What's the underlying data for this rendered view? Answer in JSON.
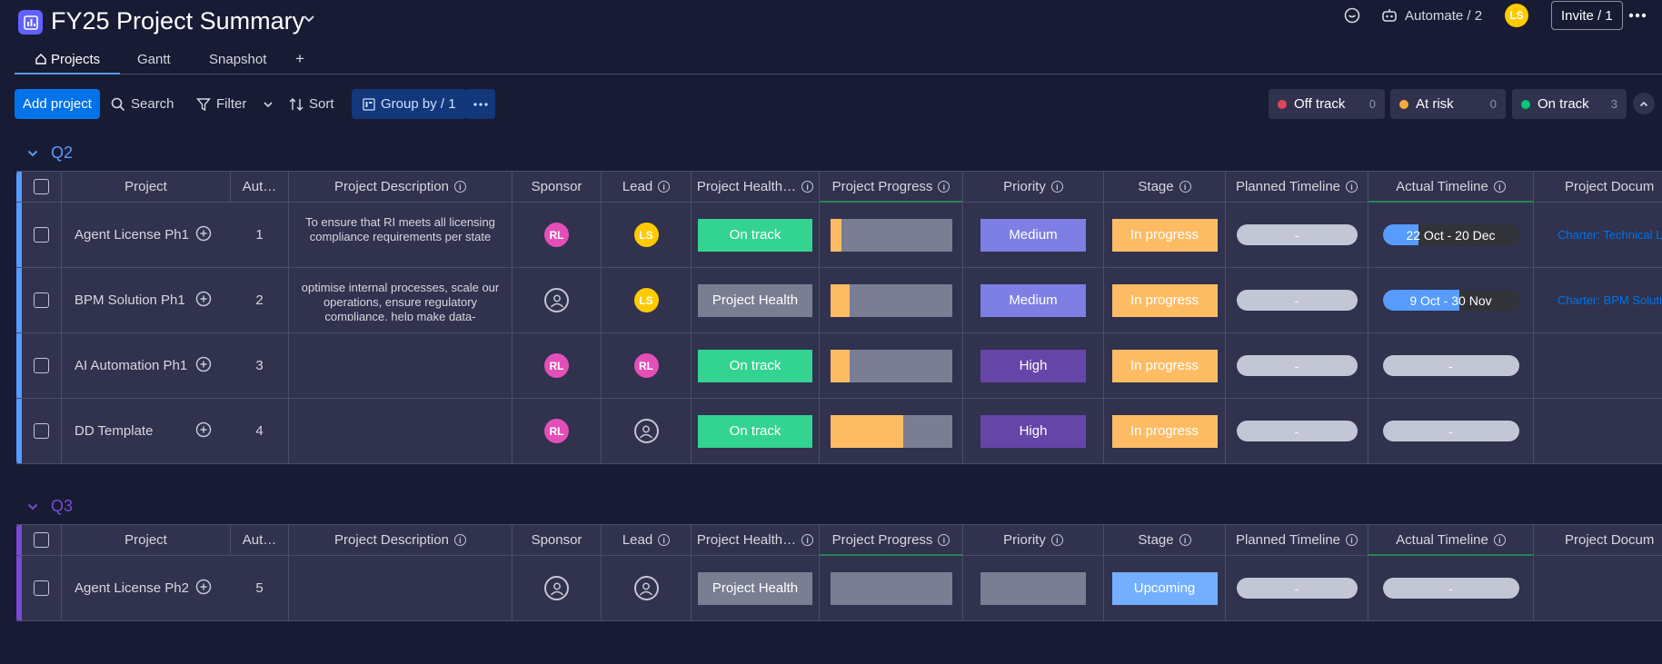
{
  "header": {
    "title": "FY25 Project Summary",
    "automate_label": "Automate / 2",
    "user_initials": "LS",
    "invite_label": "Invite / 1"
  },
  "tabs": [
    {
      "label": "Projects"
    },
    {
      "label": "Gantt"
    },
    {
      "label": "Snapshot"
    },
    {
      "label": "+"
    }
  ],
  "toolbar": {
    "add_project": "Add project",
    "search": "Search",
    "filter": "Filter",
    "sort": "Sort",
    "group_by": "Group by / 1",
    "status_chips": [
      {
        "label": "Off track",
        "count": "0",
        "color": "#e2445c"
      },
      {
        "label": "At risk",
        "count": "0",
        "color": "#fdab3d"
      },
      {
        "label": "On track",
        "count": "3",
        "color": "#00c875"
      }
    ]
  },
  "columns": {
    "project": "Project",
    "auto": "Aut…",
    "description": "Project Description",
    "sponsor": "Sponsor",
    "lead": "Lead",
    "health": "Project Health…",
    "progress": "Project Progress",
    "priority": "Priority",
    "stage": "Stage",
    "planned": "Planned Timeline",
    "actual": "Actual Timeline",
    "documents": "Project Docum"
  },
  "groups": [
    {
      "name": "Q2",
      "color": "#579bfc",
      "rows": [
        {
          "project": "Agent License Ph1",
          "auto": "1",
          "description": "To ensure that RI meets all licensing compliance requirements per state",
          "sponsor": "RL",
          "lead": "LS",
          "health": "On track",
          "progress": 0.09,
          "priority": "Medium",
          "stage": "In progress",
          "planned": "-",
          "actual": "22 Oct - 20 Dec",
          "actual_fill": 0.26,
          "document": "Charter: Technical Licensing"
        },
        {
          "project": "BPM Solution Ph1",
          "auto": "2",
          "description": "optimise internal processes, scale our operations, ensure regulatory compliance, help make data-",
          "sponsor": "",
          "lead": "LS",
          "health": "Project Health",
          "progress": 0.16,
          "priority": "Medium",
          "stage": "In progress",
          "planned": "-",
          "actual": "9 Oct - 30 Nov",
          "actual_fill": 0.56,
          "document": "Charter: BPM Solution"
        },
        {
          "project": "AI Automation Ph1",
          "auto": "3",
          "description": "",
          "sponsor": "RL",
          "lead": "RL",
          "health": "On track",
          "progress": 0.16,
          "priority": "High",
          "stage": "In progress",
          "planned": "-",
          "actual": "-",
          "actual_fill": 0,
          "document": ""
        },
        {
          "project": "DD Template",
          "auto": "4",
          "description": "",
          "sponsor": "RL",
          "lead": "",
          "health": "On track",
          "progress": 0.6,
          "priority": "High",
          "stage": "In progress",
          "planned": "-",
          "actual": "-",
          "actual_fill": 0,
          "document": ""
        }
      ]
    },
    {
      "name": "Q3",
      "color": "#784bd1",
      "rows": [
        {
          "project": "Agent License Ph2",
          "auto": "5",
          "description": "",
          "sponsor": "",
          "lead": "",
          "health": "Project Health",
          "progress": 0,
          "priority": "",
          "stage": "Upcoming",
          "planned": "-",
          "actual": "-",
          "actual_fill": 0,
          "document": ""
        }
      ]
    }
  ]
}
